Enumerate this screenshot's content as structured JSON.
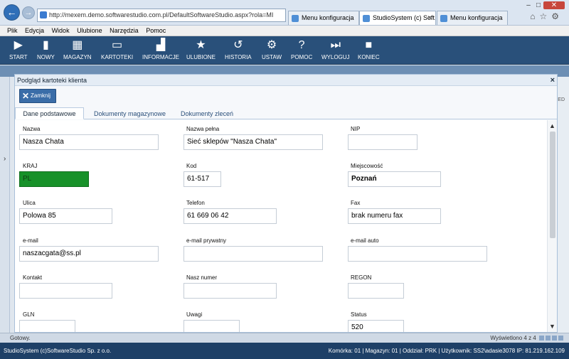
{
  "browser": {
    "address": "http://mexem.demo.softwarestudio.com.pl/DefaultSoftwareStudio.aspx?rola=MI",
    "tabs": [
      {
        "label": "Menu konfiguracja"
      },
      {
        "label": "StudioSystem (c) Soft..."
      },
      {
        "label": "Menu konfiguracja"
      }
    ],
    "menu": [
      "Plik",
      "Edycja",
      "Widok",
      "Ulubione",
      "Narzędzia",
      "Pomoc"
    ]
  },
  "toolbar": {
    "buttons": [
      {
        "label": "START",
        "icon": "play-icon",
        "glyph": "▶"
      },
      {
        "label": "NOWY",
        "icon": "new-doc-icon",
        "glyph": "▮"
      },
      {
        "label": "MAGAZYN",
        "icon": "warehouse-icon",
        "glyph": "▦"
      },
      {
        "label": "KARTOTEKI",
        "icon": "cards-icon",
        "glyph": "▭"
      },
      {
        "label": "INFORMACJE",
        "icon": "chart-icon",
        "glyph": "▟"
      },
      {
        "label": "ULUBIONE",
        "icon": "star-icon",
        "glyph": "★"
      },
      {
        "label": "HISTORIA",
        "icon": "history-icon",
        "glyph": "↺"
      },
      {
        "label": "USTAW",
        "icon": "gears-icon",
        "glyph": "⚙"
      },
      {
        "label": "POMOC",
        "icon": "help-icon",
        "glyph": "?"
      },
      {
        "label": "WYLOGUJ",
        "icon": "logout-icon",
        "glyph": "⏭"
      },
      {
        "label": "KONIEC",
        "icon": "end-icon",
        "glyph": "■"
      }
    ]
  },
  "background": {
    "right_fragment": "FED",
    "status_left": "Gotowy.",
    "pager": "Wyświetlono 4 z 4"
  },
  "dialog": {
    "title": "Podgląd kartoteki klienta",
    "close_label": "Zamknij",
    "tabs": [
      "Dane podstawowe",
      "Dokumenty magazynowe",
      "Dokumenty zleceń"
    ],
    "fields": {
      "nazwa": {
        "label": "Nazwa",
        "value": "Nasza Chata"
      },
      "nazwa_pelna": {
        "label": "Nazwa pełna",
        "value": "Sieć sklepów \"Nasza Chata\""
      },
      "nip": {
        "label": "NIP",
        "value": ""
      },
      "kraj": {
        "label": "KRAJ",
        "value": "PL"
      },
      "kod": {
        "label": "Kod",
        "value": "61-517"
      },
      "miejscowosc": {
        "label": "Miejscowość",
        "value": "Poznań"
      },
      "ulica": {
        "label": "Ulica",
        "value": "Polowa 85"
      },
      "telefon": {
        "label": "Telefon",
        "value": "61 669 06 42"
      },
      "fax": {
        "label": "Fax",
        "value": "brak numeru fax"
      },
      "email": {
        "label": "e-mail",
        "value": "naszacgata@ss.pl"
      },
      "email_prywatny": {
        "label": "e-mail prywatny",
        "value": ""
      },
      "email_auto": {
        "label": "e-mail auto",
        "value": ""
      },
      "kontakt": {
        "label": "Kontakt",
        "value": ""
      },
      "nasz_numer": {
        "label": "Nasz numer",
        "value": ""
      },
      "regon": {
        "label": "REGON",
        "value": ""
      },
      "gln": {
        "label": "GLN",
        "value": ""
      },
      "uwagi": {
        "label": "Uwagi",
        "value": ""
      },
      "status": {
        "label": "Status",
        "value": "520"
      }
    }
  },
  "statusbar": {
    "left": "StudioSystem (c)SoftwareStudio Sp. z o.o.",
    "right": "Komórka: 01 | Magazyn: 01 | Oddział: PRK | Użytkownik: SS2\\adasie3078 IP: 81.219.162.109"
  }
}
